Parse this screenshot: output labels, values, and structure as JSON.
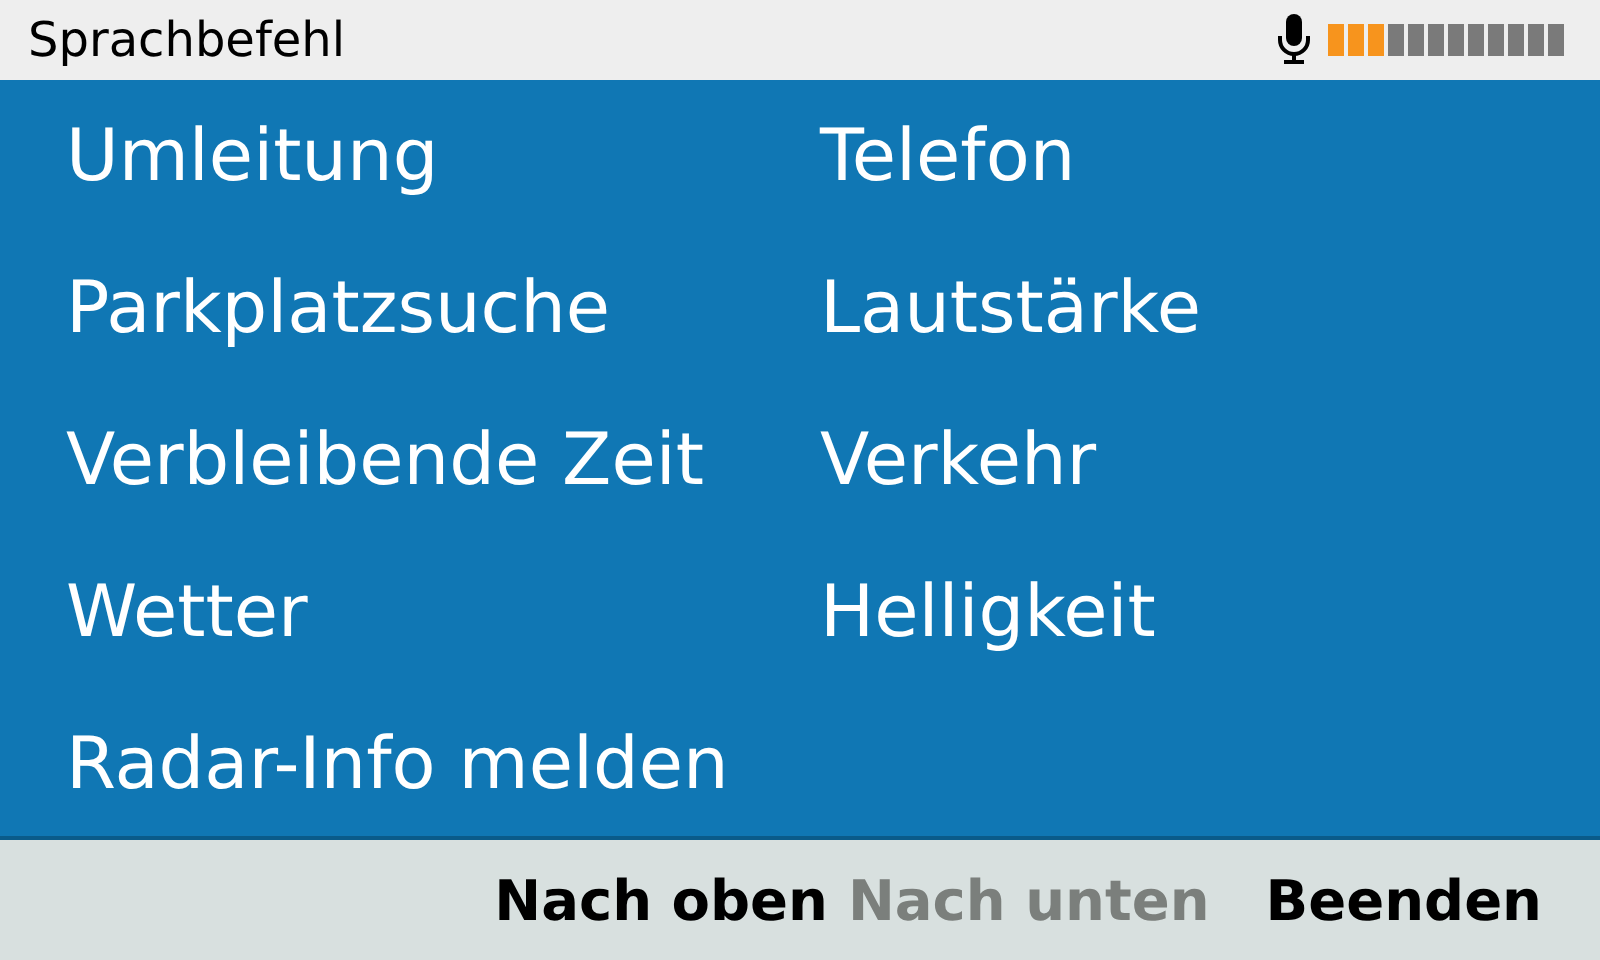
{
  "header": {
    "title": "Sprachbefehl",
    "mic_level": {
      "level": 0.25
    }
  },
  "commands": [
    {
      "label": "Umleitung"
    },
    {
      "label": "Telefon"
    },
    {
      "label": "Parkplatzsuche"
    },
    {
      "label": "Lautstärke"
    },
    {
      "label": "Verbleibende Zeit"
    },
    {
      "label": "Verkehr"
    },
    {
      "label": "Wetter"
    },
    {
      "label": "Helligkeit"
    },
    {
      "label": "Radar-Info melden"
    }
  ],
  "footer_buttons": [
    {
      "label": "Nach oben",
      "disabled": false
    },
    {
      "label": "Nach unten",
      "disabled": true
    },
    {
      "label": "Beenden",
      "disabled": false
    }
  ]
}
